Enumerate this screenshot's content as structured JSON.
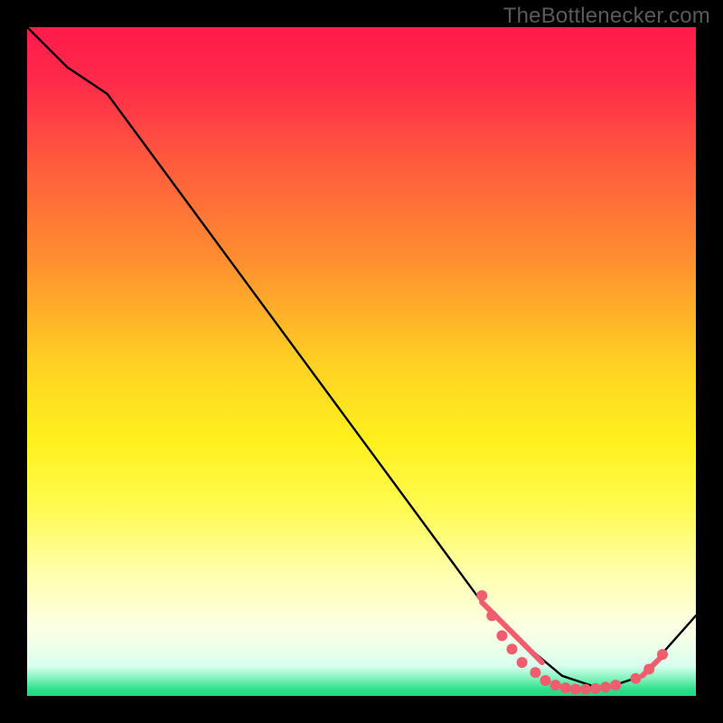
{
  "watermark": "TheBottlenecker.com",
  "chart_data": {
    "type": "line",
    "title": "",
    "xlabel": "",
    "ylabel": "",
    "xlim": [
      0,
      100
    ],
    "ylim": [
      0,
      100
    ],
    "background_gradient": {
      "stops": [
        {
          "offset": 0.0,
          "color": "#ff1a4b"
        },
        {
          "offset": 0.08,
          "color": "#ff2a4a"
        },
        {
          "offset": 0.2,
          "color": "#ff5a3e"
        },
        {
          "offset": 0.35,
          "color": "#ff8f2f"
        },
        {
          "offset": 0.5,
          "color": "#ffd023"
        },
        {
          "offset": 0.62,
          "color": "#fff11e"
        },
        {
          "offset": 0.72,
          "color": "#fffb52"
        },
        {
          "offset": 0.82,
          "color": "#ffffb0"
        },
        {
          "offset": 0.9,
          "color": "#fdffe4"
        },
        {
          "offset": 0.955,
          "color": "#d9ffef"
        },
        {
          "offset": 0.975,
          "color": "#7cf2b9"
        },
        {
          "offset": 0.99,
          "color": "#2fe08c"
        },
        {
          "offset": 1.0,
          "color": "#1fd982"
        }
      ]
    },
    "curve": {
      "x": [
        0,
        6,
        12,
        68,
        74,
        80,
        86,
        92,
        100
      ],
      "y": [
        100,
        94,
        90,
        14,
        8,
        3,
        1,
        3,
        12
      ]
    },
    "highlight_segments": [
      {
        "x": [
          68,
          77
        ],
        "y": [
          14,
          5
        ]
      },
      {
        "x": [
          92,
          95
        ],
        "y": [
          3,
          6
        ]
      }
    ],
    "markers": [
      {
        "x": 68,
        "y": 15
      },
      {
        "x": 69.5,
        "y": 12
      },
      {
        "x": 71,
        "y": 9
      },
      {
        "x": 72.5,
        "y": 7
      },
      {
        "x": 74,
        "y": 5
      },
      {
        "x": 76,
        "y": 3.5
      },
      {
        "x": 77.5,
        "y": 2.3
      },
      {
        "x": 79,
        "y": 1.6
      },
      {
        "x": 80.5,
        "y": 1.2
      },
      {
        "x": 82,
        "y": 1.0
      },
      {
        "x": 83.5,
        "y": 1.0
      },
      {
        "x": 85,
        "y": 1.1
      },
      {
        "x": 86.5,
        "y": 1.3
      },
      {
        "x": 88,
        "y": 1.6
      },
      {
        "x": 91,
        "y": 2.6
      },
      {
        "x": 93,
        "y": 4.0
      },
      {
        "x": 95,
        "y": 6.2
      }
    ],
    "marker_style": {
      "color": "#ef5d6e",
      "radius": 6
    }
  }
}
